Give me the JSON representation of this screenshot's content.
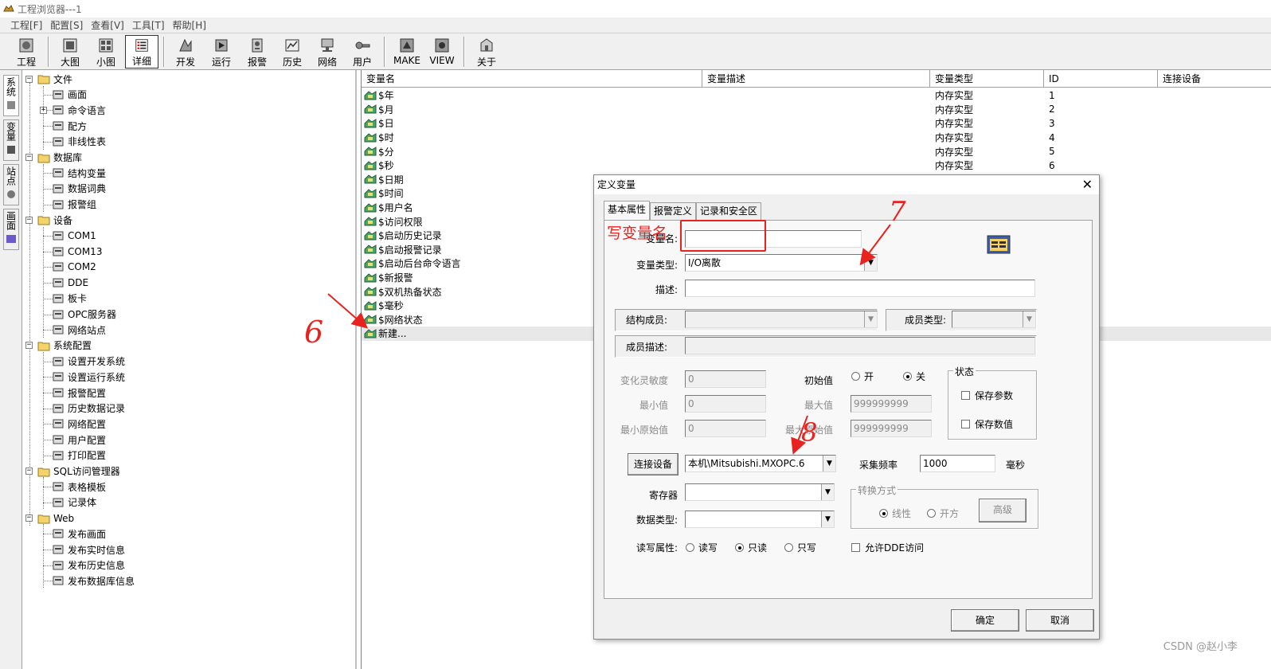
{
  "window": {
    "title": "工程浏览器---1"
  },
  "menu": [
    "工程[F]",
    "配置[S]",
    "查看[V]",
    "工具[T]",
    "帮助[H]"
  ],
  "toolbar": {
    "buttons": [
      {
        "label": "工程",
        "icon": "project-icon"
      },
      {
        "label": "大图",
        "icon": "large-icons-icon"
      },
      {
        "label": "小图",
        "icon": "small-icons-icon"
      },
      {
        "label": "详细",
        "icon": "details-icon",
        "active": true
      },
      {
        "label": "开发",
        "icon": "develop-icon"
      },
      {
        "label": "运行",
        "icon": "run-icon"
      },
      {
        "label": "报警",
        "icon": "alarm-icon"
      },
      {
        "label": "历史",
        "icon": "history-icon"
      },
      {
        "label": "网络",
        "icon": "network-icon"
      },
      {
        "label": "用户",
        "icon": "user-icon"
      },
      {
        "label": "MAKE",
        "icon": "make-icon"
      },
      {
        "label": "VIEW",
        "icon": "view-icon"
      },
      {
        "label": "关于",
        "icon": "about-icon"
      }
    ]
  },
  "side_tabs": [
    "系统",
    "变量",
    "站点",
    "画面"
  ],
  "tree": [
    {
      "label": "文件",
      "level": 0,
      "expander": "⊟"
    },
    {
      "label": "画面",
      "level": 1
    },
    {
      "label": "命令语言",
      "level": 1,
      "expander": "⊞"
    },
    {
      "label": "配方",
      "level": 1
    },
    {
      "label": "非线性表",
      "level": 1
    },
    {
      "label": "数据库",
      "level": 0,
      "expander": "⊟"
    },
    {
      "label": "结构变量",
      "level": 1
    },
    {
      "label": "数据词典",
      "level": 1
    },
    {
      "label": "报警组",
      "level": 1
    },
    {
      "label": "设备",
      "level": 0,
      "expander": "⊟"
    },
    {
      "label": "COM1",
      "level": 1
    },
    {
      "label": "COM13",
      "level": 1
    },
    {
      "label": "COM2",
      "level": 1
    },
    {
      "label": "DDE",
      "level": 1
    },
    {
      "label": "板卡",
      "level": 1
    },
    {
      "label": "OPC服务器",
      "level": 1
    },
    {
      "label": "网络站点",
      "level": 1
    },
    {
      "label": "系统配置",
      "level": 0,
      "expander": "⊟"
    },
    {
      "label": "设置开发系统",
      "level": 1
    },
    {
      "label": "设置运行系统",
      "level": 1
    },
    {
      "label": "报警配置",
      "level": 1
    },
    {
      "label": "历史数据记录",
      "level": 1
    },
    {
      "label": "网络配置",
      "level": 1
    },
    {
      "label": "用户配置",
      "level": 1
    },
    {
      "label": "打印配置",
      "level": 1
    },
    {
      "label": "SQL访问管理器",
      "level": 0,
      "expander": "⊟"
    },
    {
      "label": "表格模板",
      "level": 1
    },
    {
      "label": "记录体",
      "level": 1
    },
    {
      "label": "Web",
      "level": 0,
      "expander": "⊟"
    },
    {
      "label": "发布画面",
      "level": 1
    },
    {
      "label": "发布实时信息",
      "level": 1
    },
    {
      "label": "发布历史信息",
      "level": 1
    },
    {
      "label": "发布数据库信息",
      "level": 1
    }
  ],
  "list": {
    "columns": [
      "变量名",
      "变量描述",
      "变量类型",
      "ID",
      "连接设备"
    ],
    "rows": [
      {
        "name": "$年",
        "type": "内存实型",
        "id": "1"
      },
      {
        "name": "$月",
        "type": "内存实型",
        "id": "2"
      },
      {
        "name": "$日",
        "type": "内存实型",
        "id": "3"
      },
      {
        "name": "$时",
        "type": "内存实型",
        "id": "4"
      },
      {
        "name": "$分",
        "type": "内存实型",
        "id": "5"
      },
      {
        "name": "$秒",
        "type": "内存实型",
        "id": "6"
      },
      {
        "name": "$日期",
        "type": "",
        "id": ""
      },
      {
        "name": "$时间",
        "type": "",
        "id": ""
      },
      {
        "name": "$用户名",
        "type": "",
        "id": ""
      },
      {
        "name": "$访问权限",
        "type": "",
        "id": ""
      },
      {
        "name": "$启动历史记录",
        "type": "",
        "id": ""
      },
      {
        "name": "$启动报警记录",
        "type": "",
        "id": ""
      },
      {
        "name": "$启动后台命令语言",
        "type": "",
        "id": ""
      },
      {
        "name": "$新报警",
        "type": "",
        "id": ""
      },
      {
        "name": "$双机热备状态",
        "type": "",
        "id": ""
      },
      {
        "name": "$毫秒",
        "type": "",
        "id": ""
      },
      {
        "name": "$网络状态",
        "type": "",
        "id": ""
      },
      {
        "name": "新建...",
        "type": "",
        "id": "",
        "highlight": true
      }
    ]
  },
  "dialog": {
    "title": "定义变量",
    "close": "✕",
    "tabs": [
      "基本属性",
      "报警定义",
      "记录和安全区"
    ],
    "var_name_label": "变量名:",
    "var_name_value": "",
    "var_type_label": "变量类型:",
    "var_type_value": "I/O离散",
    "desc_label": "描述:",
    "desc_value": "",
    "struct_member_label": "结构成员:",
    "member_type_label": "成员类型:",
    "member_desc_label": "成员描述:",
    "sensitivity_label": "变化灵敏度",
    "sensitivity_value": "0",
    "initial_label": "初始值",
    "initial_on": "开",
    "initial_off": "关",
    "min_label": "最小值",
    "min_value": "0",
    "max_label": "最大值",
    "max_value": "999999999",
    "min_raw_label": "最小原始值",
    "min_raw_value": "0",
    "max_raw_label": "最大原始值",
    "max_raw_value": "999999999",
    "state_group": "状态",
    "keep_param": "保存参数",
    "keep_value": "保存数值",
    "connect_device_btn": "连接设备",
    "device_value": "本机\\Mitsubishi.MXOPC.6",
    "sample_freq_label": "采集频率",
    "sample_freq_value": "1000",
    "ms_label": "毫秒",
    "register_label": "寄存器",
    "register_value": "",
    "convert_group": "转换方式",
    "linear": "线性",
    "sqrt": "开方",
    "advanced_btn": "高级",
    "data_type_label": "数据类型:",
    "data_type_value": "",
    "rw_label": "读写属性:",
    "rw_options": [
      "读写",
      "只读",
      "只写"
    ],
    "allow_dde": "允许DDE访问",
    "ok_btn": "确定",
    "cancel_btn": "取消"
  },
  "annotations": {
    "write_var_name": "写变量名",
    "n6": "6",
    "n7": "7",
    "n8": "8",
    "color": "#e8231f"
  },
  "watermark": "CSDN @赵小李"
}
